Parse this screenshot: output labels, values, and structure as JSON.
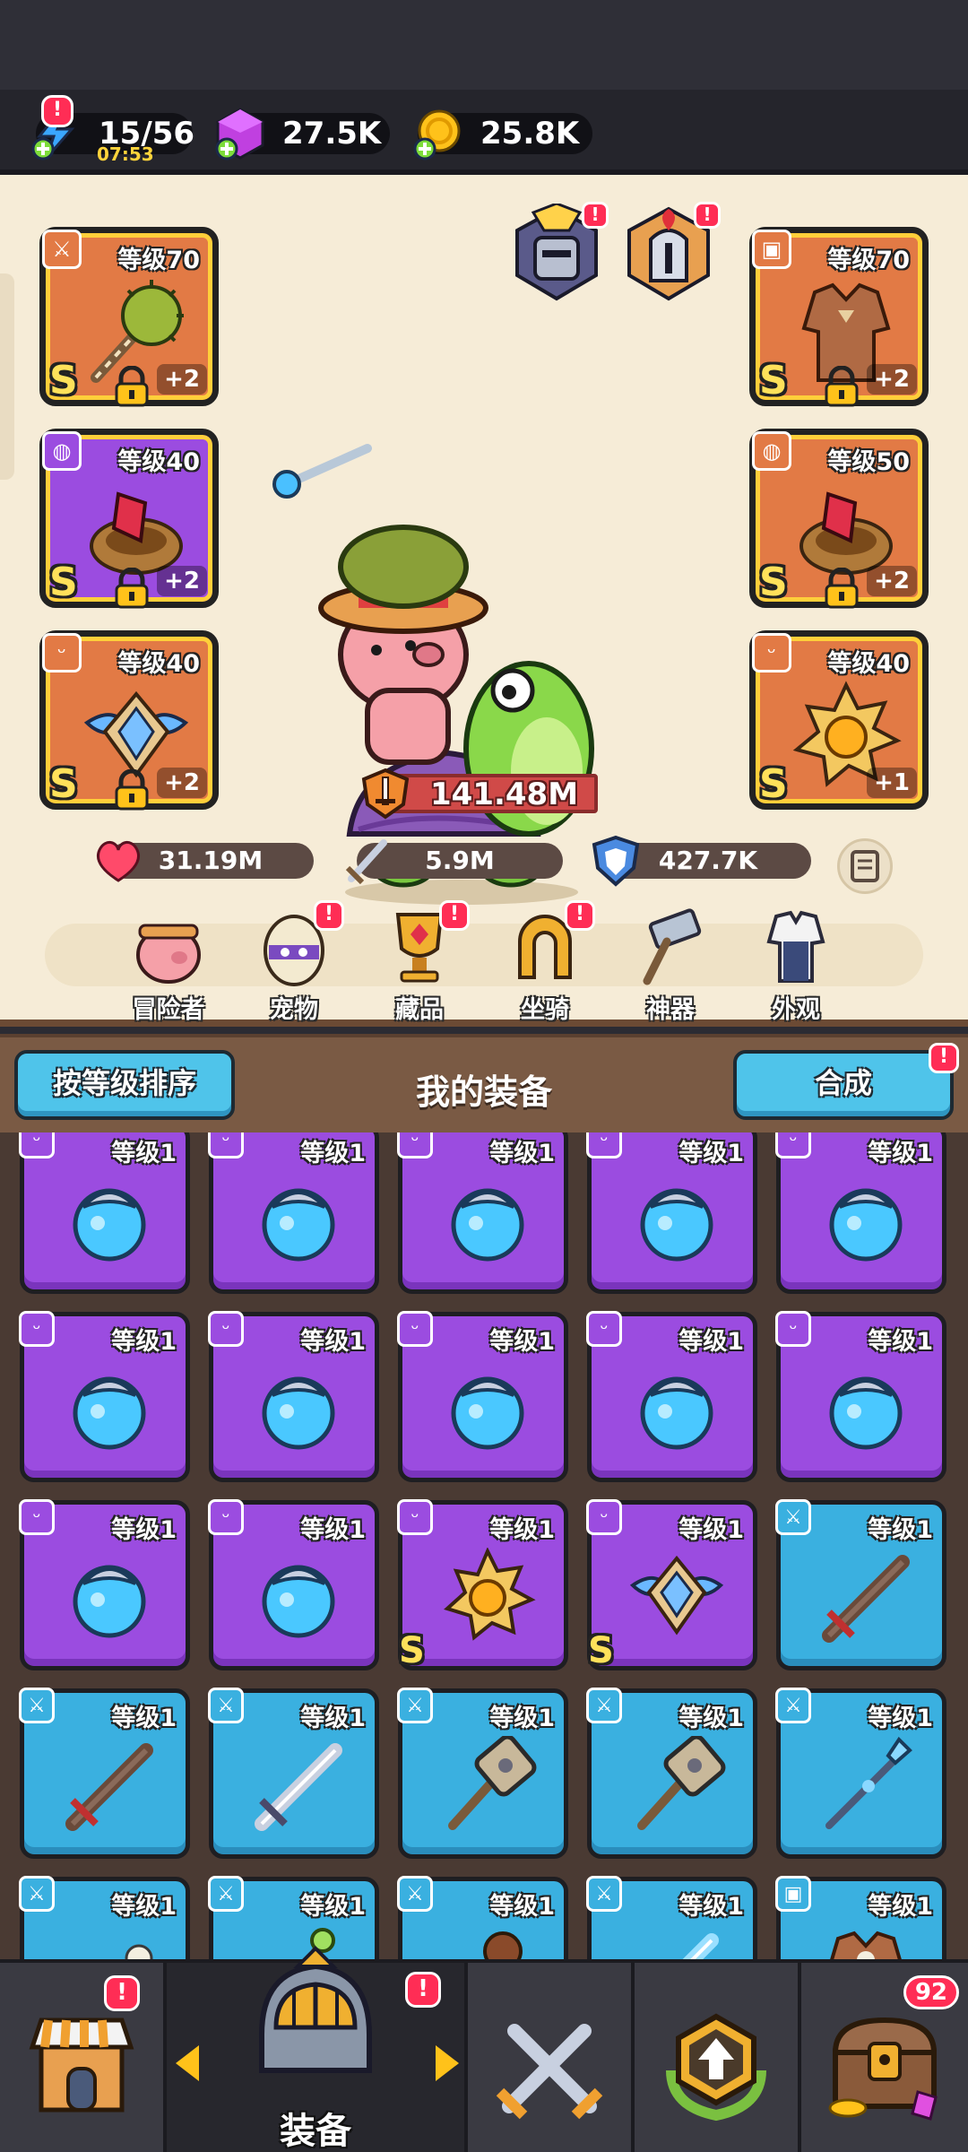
{
  "resources": {
    "energy": {
      "value": "15/56",
      "timer": "07:53",
      "alert": "!"
    },
    "gems": {
      "value": "27.5K"
    },
    "coins": {
      "value": "25.8K"
    }
  },
  "hero": {
    "left_slots": [
      {
        "level": "等级70",
        "grade": "S",
        "plus": "+2",
        "color": "orange",
        "type": "weapon",
        "art": "spiked-mace"
      },
      {
        "level": "等级40",
        "grade": "S",
        "plus": "+2",
        "color": "purple",
        "type": "ring",
        "art": "ruby-bracer"
      },
      {
        "level": "等级40",
        "grade": "S",
        "plus": "+2",
        "color": "orange",
        "type": "necklace",
        "art": "winged-crest"
      }
    ],
    "right_slots": [
      {
        "level": "等级70",
        "grade": "S",
        "plus": "+2",
        "color": "orange",
        "type": "armor",
        "art": "leather-armor"
      },
      {
        "level": "等级50",
        "grade": "S",
        "plus": "+2",
        "color": "orange",
        "type": "ring",
        "art": "ruby-bracer"
      },
      {
        "level": "等级40",
        "grade": "S",
        "plus": "+1",
        "color": "orange",
        "type": "necklace",
        "art": "sun-medal"
      }
    ],
    "skin_alert": "!",
    "power": "141.48M",
    "stats": {
      "health": "31.19M",
      "attack": "5.9M",
      "defense": "427.7K"
    }
  },
  "categories": [
    {
      "label": "冒险者",
      "icon": "pig-adventurer-icon",
      "alert": ""
    },
    {
      "label": "宠物",
      "icon": "pet-egg-icon",
      "alert": "!"
    },
    {
      "label": "藏品",
      "icon": "trophy-icon",
      "alert": "!"
    },
    {
      "label": "坐骑",
      "icon": "horseshoe-icon",
      "alert": "!"
    },
    {
      "label": "神器",
      "icon": "hammer-icon",
      "alert": ""
    },
    {
      "label": "外观",
      "icon": "outfit-icon",
      "alert": ""
    }
  ],
  "inventory_header": {
    "sort_label": "按等级排序",
    "title": "我的装备",
    "merge_label": "合成",
    "merge_alert": "!"
  },
  "inventory": [
    {
      "level": "等级1",
      "color": "purple",
      "type": "necklace",
      "art": "blue-orb",
      "grade": ""
    },
    {
      "level": "等级1",
      "color": "purple",
      "type": "necklace",
      "art": "blue-orb",
      "grade": ""
    },
    {
      "level": "等级1",
      "color": "purple",
      "type": "necklace",
      "art": "blue-orb",
      "grade": ""
    },
    {
      "level": "等级1",
      "color": "purple",
      "type": "necklace",
      "art": "blue-orb",
      "grade": ""
    },
    {
      "level": "等级1",
      "color": "purple",
      "type": "necklace",
      "art": "blue-orb",
      "grade": ""
    },
    {
      "level": "等级1",
      "color": "purple",
      "type": "necklace",
      "art": "blue-orb",
      "grade": ""
    },
    {
      "level": "等级1",
      "color": "purple",
      "type": "necklace",
      "art": "blue-orb",
      "grade": ""
    },
    {
      "level": "等级1",
      "color": "purple",
      "type": "necklace",
      "art": "blue-orb",
      "grade": ""
    },
    {
      "level": "等级1",
      "color": "purple",
      "type": "necklace",
      "art": "blue-orb",
      "grade": ""
    },
    {
      "level": "等级1",
      "color": "purple",
      "type": "necklace",
      "art": "blue-orb",
      "grade": ""
    },
    {
      "level": "等级1",
      "color": "purple",
      "type": "necklace",
      "art": "blue-orb",
      "grade": ""
    },
    {
      "level": "等级1",
      "color": "purple",
      "type": "necklace",
      "art": "blue-orb",
      "grade": ""
    },
    {
      "level": "等级1",
      "color": "purple",
      "type": "necklace",
      "art": "sun-medal",
      "grade": "S"
    },
    {
      "level": "等级1",
      "color": "purple",
      "type": "necklace",
      "art": "winged-crest",
      "grade": "S"
    },
    {
      "level": "等级1",
      "color": "blue",
      "type": "weapon",
      "art": "wood-sword",
      "grade": ""
    },
    {
      "level": "等级1",
      "color": "blue",
      "type": "weapon",
      "art": "wood-sword",
      "grade": ""
    },
    {
      "level": "等级1",
      "color": "blue",
      "type": "weapon",
      "art": "steel-sword",
      "grade": ""
    },
    {
      "level": "等级1",
      "color": "blue",
      "type": "weapon",
      "art": "war-hammer",
      "grade": ""
    },
    {
      "level": "等级1",
      "color": "blue",
      "type": "weapon",
      "art": "war-hammer",
      "grade": ""
    },
    {
      "level": "等级1",
      "color": "blue",
      "type": "weapon",
      "art": "crystal-spear",
      "grade": ""
    },
    {
      "level": "等级1",
      "color": "blue",
      "type": "weapon",
      "art": "bone-club",
      "grade": ""
    },
    {
      "level": "等级1",
      "color": "blue",
      "type": "weapon",
      "art": "staff",
      "grade": ""
    },
    {
      "level": "等级1",
      "color": "blue",
      "type": "weapon",
      "art": "root-club",
      "grade": ""
    },
    {
      "level": "等级1",
      "color": "blue",
      "type": "weapon",
      "art": "ice-sword",
      "grade": ""
    },
    {
      "level": "等级1",
      "color": "blue",
      "type": "armor",
      "art": "leather-armor",
      "grade": ""
    }
  ],
  "bottom_nav": [
    {
      "label": "",
      "icon": "shop-icon",
      "alert": "!",
      "count": ""
    },
    {
      "label": "装备",
      "icon": "helmet-icon",
      "alert": "!",
      "count": ""
    },
    {
      "label": "",
      "icon": "crossed-swords-icon",
      "alert": "",
      "count": ""
    },
    {
      "label": "",
      "icon": "upgrade-emblem-icon",
      "alert": "",
      "count": ""
    },
    {
      "label": "",
      "icon": "treasure-chest-icon",
      "alert": "",
      "count": "92"
    }
  ],
  "colors": {
    "slot_orange": "#e27a45",
    "slot_purple": "#9b4ce0",
    "slot_blue": "#3ab0e0",
    "alert": "#ff2d55",
    "button_blue": "#4fc4ea",
    "panel_cream": "#f6ecd7"
  }
}
